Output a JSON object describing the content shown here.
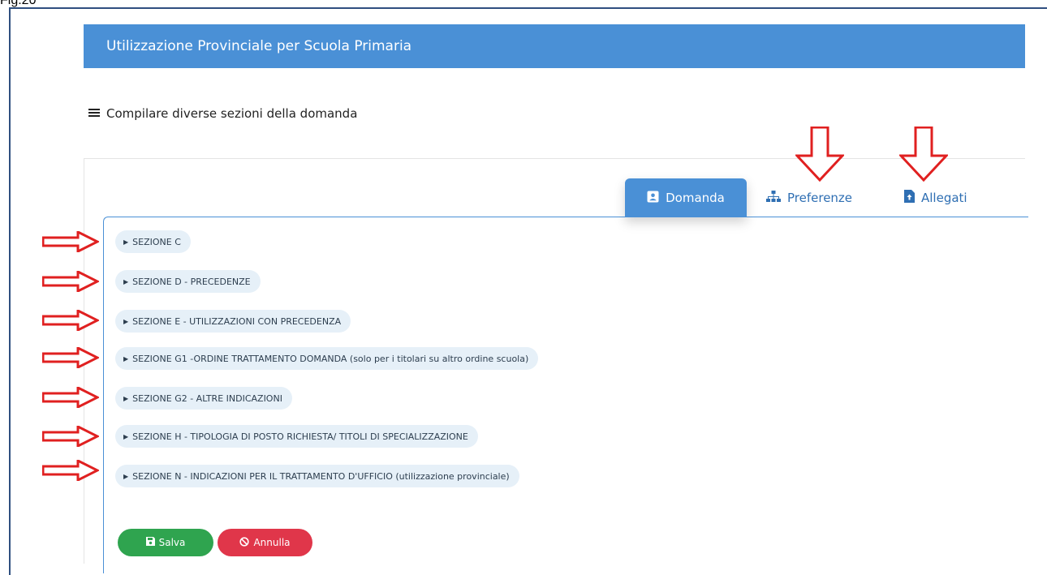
{
  "figure_label": "Fig.20",
  "header": {
    "title": "Utilizzazione Provinciale per Scuola Primaria"
  },
  "instruction": {
    "text": "Compilare diverse sezioni della domanda",
    "icon": "list-icon"
  },
  "tabs": [
    {
      "label": "Domanda",
      "icon": "id-card-icon",
      "active": true
    },
    {
      "label": "Preferenze",
      "icon": "sitemap-icon",
      "active": false
    },
    {
      "label": "Allegati",
      "icon": "file-upload-icon",
      "active": false
    }
  ],
  "sections": [
    {
      "label": "SEZIONE C"
    },
    {
      "label": "SEZIONE D - PRECEDENZE"
    },
    {
      "label": "SEZIONE E - UTILIZZAZIONI CON PRECEDENZA"
    },
    {
      "label": "SEZIONE G1 -ORDINE TRATTAMENTO DOMANDA (solo per i titolari su altro ordine scuola)"
    },
    {
      "label": "SEZIONE G2 - ALTRE INDICAZIONI"
    },
    {
      "label": "SEZIONE H - TIPOLOGIA DI POSTO RICHIESTA/ TITOLI DI SPECIALIZZAZIONE"
    },
    {
      "label": "SEZIONE N - INDICAZIONI PER IL TRATTAMENTO D'UFFICIO (utilizzazione provinciale)"
    }
  ],
  "buttons": {
    "save": {
      "label": "Salva",
      "icon": "floppy-disk-icon"
    },
    "cancel": {
      "label": "Annulla",
      "icon": "ban-icon"
    }
  },
  "colors": {
    "header": "#4a90d6",
    "tab_active": "#4a90d6",
    "section_pill": "#e6f0f8",
    "save": "#2fa44f",
    "cancel": "#e0364a",
    "annotation_arrow": "#e02020"
  }
}
